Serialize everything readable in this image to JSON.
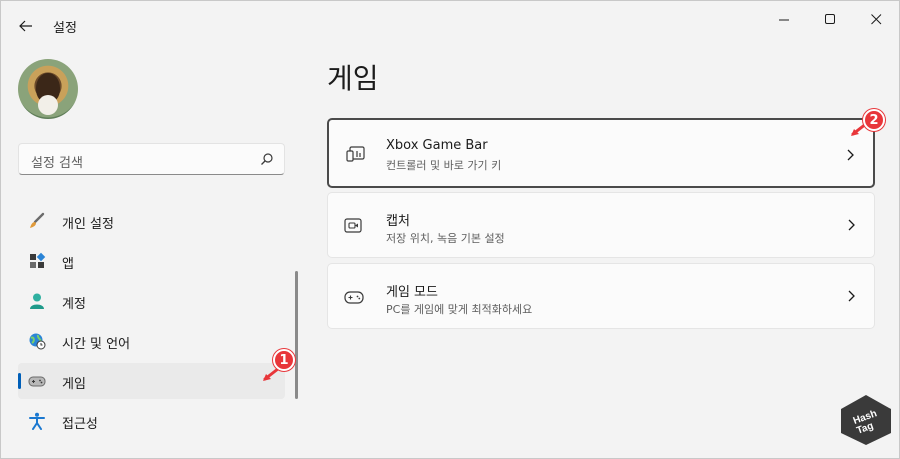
{
  "window": {
    "title": "설정",
    "back_icon": "back-arrow-icon",
    "controls": [
      "minimize-icon",
      "maximize-icon",
      "close-icon"
    ]
  },
  "search": {
    "placeholder": "설정 검색"
  },
  "sidebar": {
    "items": [
      {
        "label": "개인 설정",
        "icon": "brush-icon"
      },
      {
        "label": "앱",
        "icon": "apps-icon"
      },
      {
        "label": "계정",
        "icon": "account-icon"
      },
      {
        "label": "시간 및 언어",
        "icon": "globe-clock-icon"
      },
      {
        "label": "게임",
        "icon": "gamepad-icon",
        "active": true
      },
      {
        "label": "접근성",
        "icon": "accessibility-icon"
      }
    ]
  },
  "main": {
    "title": "게임",
    "cards": [
      {
        "title": "Xbox Game Bar",
        "subtitle": "컨트롤러 및 바로 가기 키",
        "icon": "game-bar-icon"
      },
      {
        "title": "캡처",
        "subtitle": "저장 위치, 녹음 기본 설정",
        "icon": "capture-icon"
      },
      {
        "title": "게임 모드",
        "subtitle": "PC를 게임에 맞게 최적화하세요",
        "icon": "game-mode-icon"
      }
    ]
  },
  "markers": {
    "one": "1",
    "two": "2"
  },
  "watermark": {
    "line1": "Hash",
    "line2": "Tag"
  },
  "colors": {
    "accent": "#005fb8",
    "marker": "#e8363a",
    "background": "#f3f3f3"
  }
}
